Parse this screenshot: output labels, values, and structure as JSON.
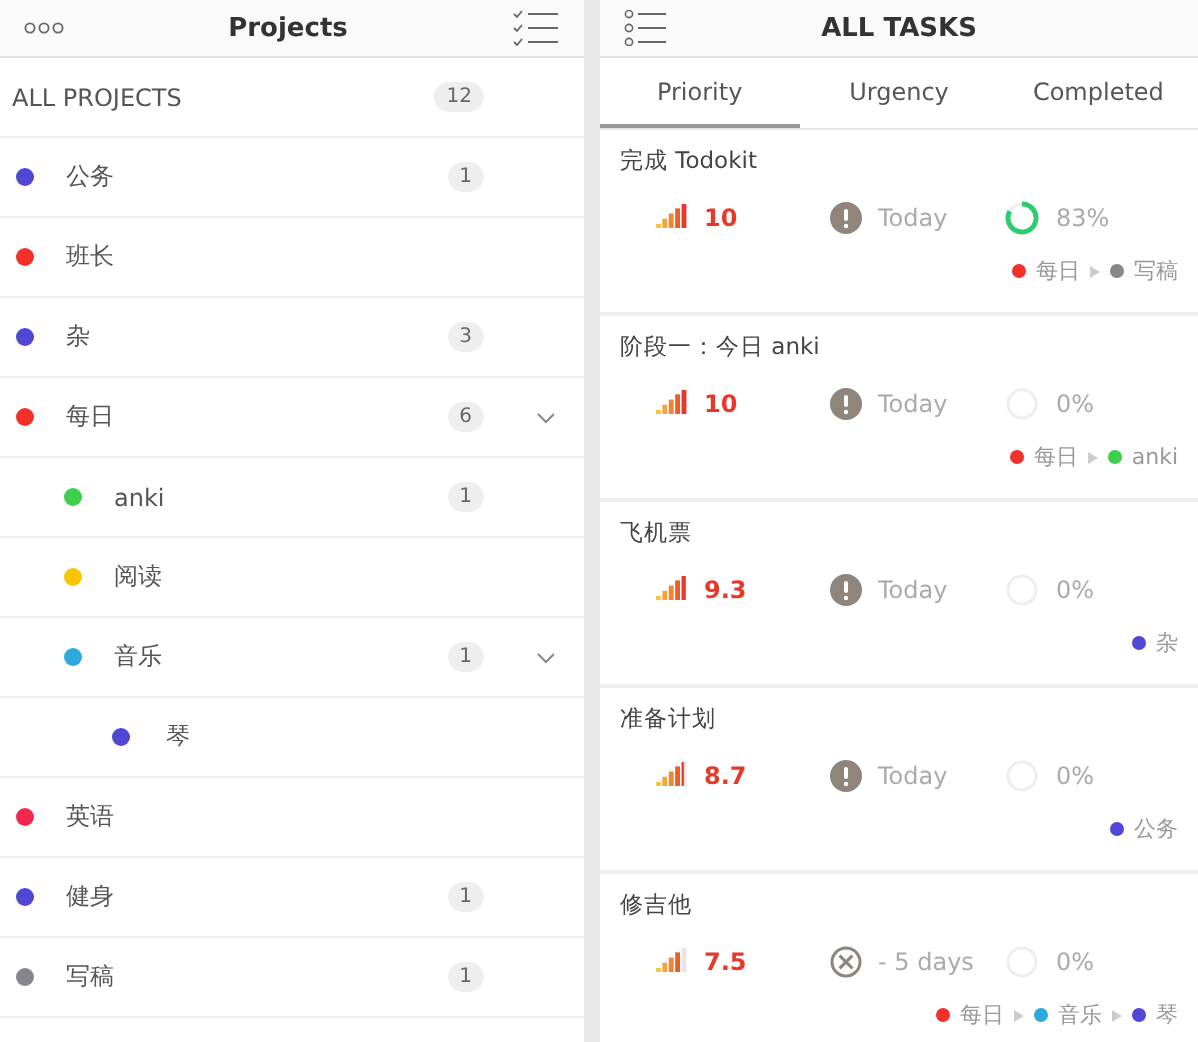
{
  "projects_panel": {
    "title": "Projects",
    "all": {
      "label": "ALL PROJECTS",
      "count": "12"
    },
    "projects": [
      {
        "name": "公务",
        "color": "#5246d6",
        "count": "1"
      },
      {
        "name": "班长",
        "color": "#f2322a"
      },
      {
        "name": "杂",
        "color": "#5246d6",
        "count": "3"
      },
      {
        "name": "每日",
        "color": "#f2322a",
        "count": "6",
        "expanded": true,
        "children": [
          {
            "name": "anki",
            "color": "#3ecf4c",
            "count": "1"
          },
          {
            "name": "阅读",
            "color": "#f7c600"
          },
          {
            "name": "音乐",
            "color": "#2ea9de",
            "count": "1",
            "expanded": true,
            "children": [
              {
                "name": "琴",
                "color": "#5246d6"
              }
            ]
          }
        ]
      },
      {
        "name": "英语",
        "color": "#f2294e"
      },
      {
        "name": "健身",
        "color": "#5246d6",
        "count": "1"
      },
      {
        "name": "写稿",
        "color": "#86868c",
        "count": "1"
      }
    ]
  },
  "tasks_panel": {
    "title": "ALL TASKS",
    "tabs": [
      {
        "label": "Priority",
        "selected": true
      },
      {
        "label": "Urgency",
        "selected": false
      },
      {
        "label": "Completed",
        "selected": false
      }
    ],
    "tasks": [
      {
        "title": "完成 Todokit",
        "priority": "10",
        "due": {
          "kind": "alert",
          "text": "Today"
        },
        "progress": "83%",
        "path": [
          {
            "name": "每日",
            "color": "#f2322a"
          },
          {
            "name": "写稿",
            "color": "#86868c"
          }
        ]
      },
      {
        "title": "阶段一：今日 anki",
        "priority": "10",
        "due": {
          "kind": "alert",
          "text": "Today"
        },
        "progress": "0%",
        "path": [
          {
            "name": "每日",
            "color": "#f2322a"
          },
          {
            "name": "anki",
            "color": "#3ecf4c"
          }
        ]
      },
      {
        "title": "飞机票",
        "priority": "9.3",
        "due": {
          "kind": "alert",
          "text": "Today"
        },
        "progress": "0%",
        "path": [
          {
            "name": "杂",
            "color": "#5246d6"
          }
        ]
      },
      {
        "title": "准备计划",
        "priority": "8.7",
        "due": {
          "kind": "alert",
          "text": "Today"
        },
        "progress": "0%",
        "path": [
          {
            "name": "公务",
            "color": "#5246d6"
          }
        ]
      },
      {
        "title": "修吉他",
        "priority": "7.5",
        "due": {
          "kind": "overdue",
          "text": "- 5 days"
        },
        "progress": "0%",
        "path": [
          {
            "name": "每日",
            "color": "#f2322a"
          },
          {
            "name": "音乐",
            "color": "#2ea9de"
          },
          {
            "name": "琴",
            "color": "#5246d6"
          }
        ]
      }
    ]
  }
}
